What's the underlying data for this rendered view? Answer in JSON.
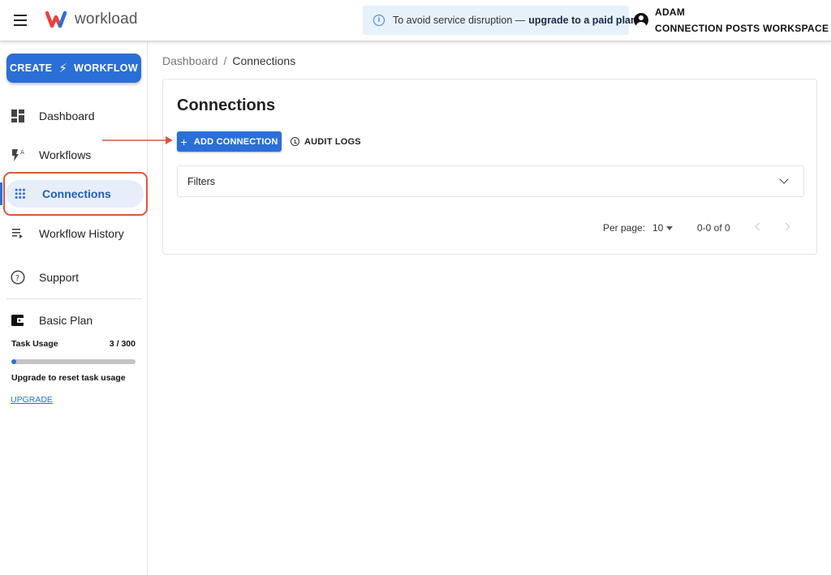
{
  "header": {
    "logo_text": "workload",
    "banner_text": "To avoid service disruption —",
    "banner_link": "upgrade to a paid plan.",
    "user_name": "ADAM",
    "workspace_name": "CONNECTION POSTS WORKSPACE"
  },
  "sidebar": {
    "create_before": "CREATE",
    "create_after": "WORKFLOW",
    "items": [
      {
        "label": "Dashboard"
      },
      {
        "label": "Workflows"
      },
      {
        "label": "Connections"
      },
      {
        "label": "Workflow History"
      },
      {
        "label": "Support"
      }
    ],
    "plan_label": "Basic Plan",
    "task_usage_label": "Task Usage",
    "task_usage_value": "3 / 300",
    "task_usage_fraction": 0.01,
    "upgrade_note": "Upgrade to reset task usage",
    "upgrade_link": "UPGRADE"
  },
  "breadcrumb": {
    "root": "Dashboard",
    "separator": "/",
    "current": "Connections"
  },
  "main": {
    "title": "Connections",
    "add_button": "ADD CONNECTION",
    "audit_button": "AUDIT LOGS",
    "filters_label": "Filters",
    "pagination": {
      "per_page_label": "Per page:",
      "per_page_value": "10",
      "range_text": "0-0 of 0"
    }
  },
  "colors": {
    "accent": "#2a6fd8",
    "annotation": "#d9573f"
  }
}
